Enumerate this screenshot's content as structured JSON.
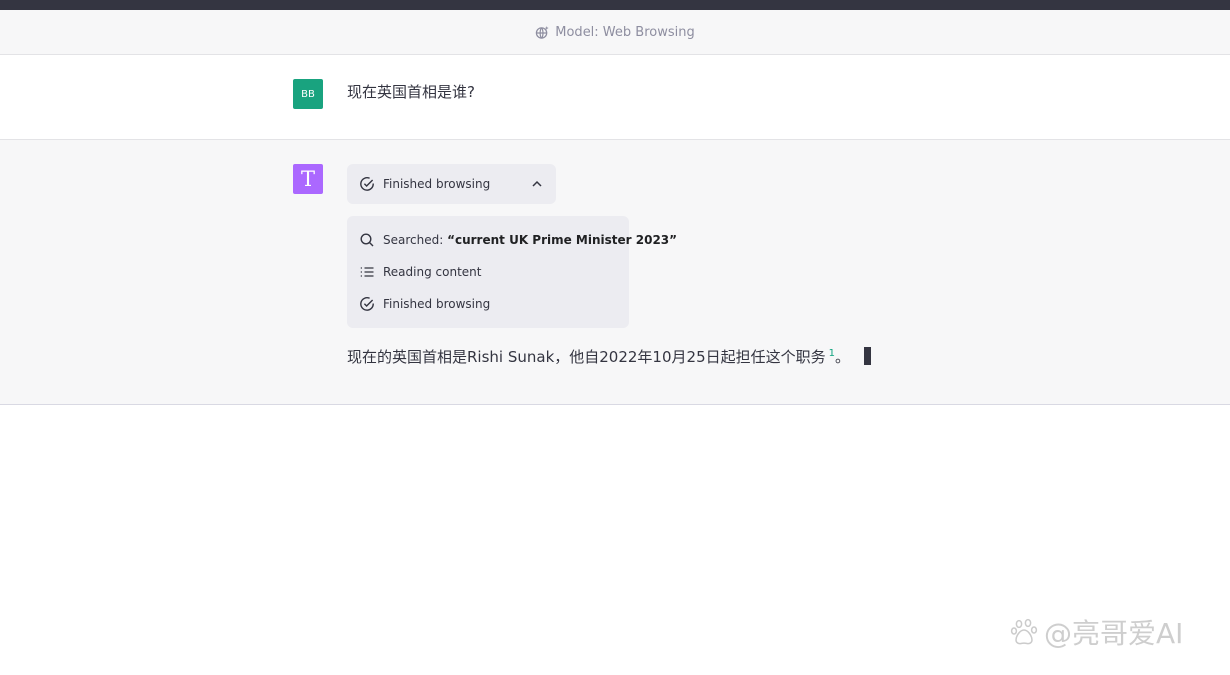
{
  "header": {
    "model_label": "Model: Web Browsing",
    "model_icon": "globe-sparkle-icon"
  },
  "user_message": {
    "avatar_text": "BB",
    "avatar_color": "#19a37f",
    "text": "现在英国首相是谁?"
  },
  "assistant_message": {
    "avatar_text": "T",
    "avatar_color": "#ab68ff",
    "browse_toggle": {
      "label": "Finished browsing",
      "icon": "check-circle-icon",
      "expanded": true
    },
    "steps": [
      {
        "icon": "search-icon",
        "label": "Searched: ",
        "query": "“current UK Prime Minister 2023”"
      },
      {
        "icon": "list-icon",
        "label": "Reading content"
      },
      {
        "icon": "check-circle-icon",
        "label": "Finished browsing"
      }
    ],
    "answer_text": "现在的英国首相是Rishi Sunak，他自2022年10月25日起担任这个职务",
    "citation": "1",
    "answer_suffix": "。"
  },
  "watermark": {
    "text": "@亮哥爱AI",
    "icon": "baidu-paw-icon"
  },
  "colors": {
    "accent": "#10a37f",
    "topbar": "#343541",
    "panel": "#ececf1"
  }
}
